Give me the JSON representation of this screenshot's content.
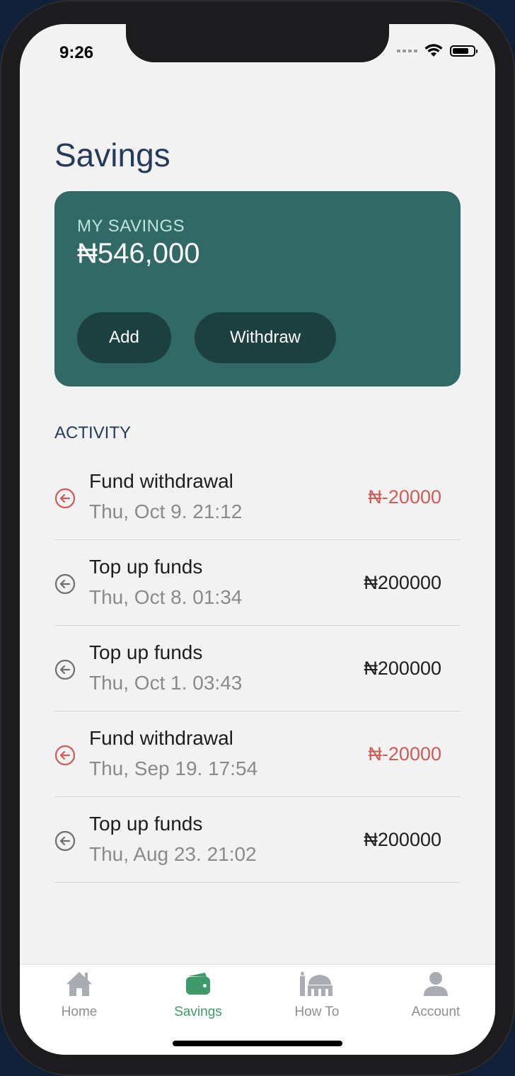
{
  "status_bar": {
    "time": "9:26"
  },
  "header": {
    "title": "Savings"
  },
  "savings_card": {
    "label": "MY SAVINGS",
    "amount": "₦546,000",
    "add_label": "Add",
    "withdraw_label": "Withdraw"
  },
  "activity": {
    "section_label": "ACTIVITY",
    "items": [
      {
        "title": "Fund withdrawal",
        "date": "Thu, Oct 9. 21:12",
        "amount": "₦-20000",
        "kind": "withdrawal"
      },
      {
        "title": "Top up funds",
        "date": "Thu, Oct 8. 01:34",
        "amount": "₦200000",
        "kind": "topup"
      },
      {
        "title": "Top up funds",
        "date": "Thu, Oct 1. 03:43",
        "amount": "₦200000",
        "kind": "topup"
      },
      {
        "title": "Fund withdrawal",
        "date": "Thu, Sep 19. 17:54",
        "amount": "₦-20000",
        "kind": "withdrawal"
      },
      {
        "title": "Top up funds",
        "date": "Thu, Aug 23. 21:02",
        "amount": "₦200000",
        "kind": "topup"
      }
    ]
  },
  "tabbar": {
    "tabs": [
      {
        "label": "Home",
        "icon": "home-icon",
        "active": false
      },
      {
        "label": "Savings",
        "icon": "wallet-icon",
        "active": true
      },
      {
        "label": "How To",
        "icon": "mosque-icon",
        "active": false
      },
      {
        "label": "Account",
        "icon": "person-icon",
        "active": false
      }
    ]
  },
  "colors": {
    "card": "#316966",
    "button": "#1b403f",
    "title": "#243b5a",
    "withdrawal": "#cf5d57",
    "active_tab": "#3f9a6a"
  }
}
